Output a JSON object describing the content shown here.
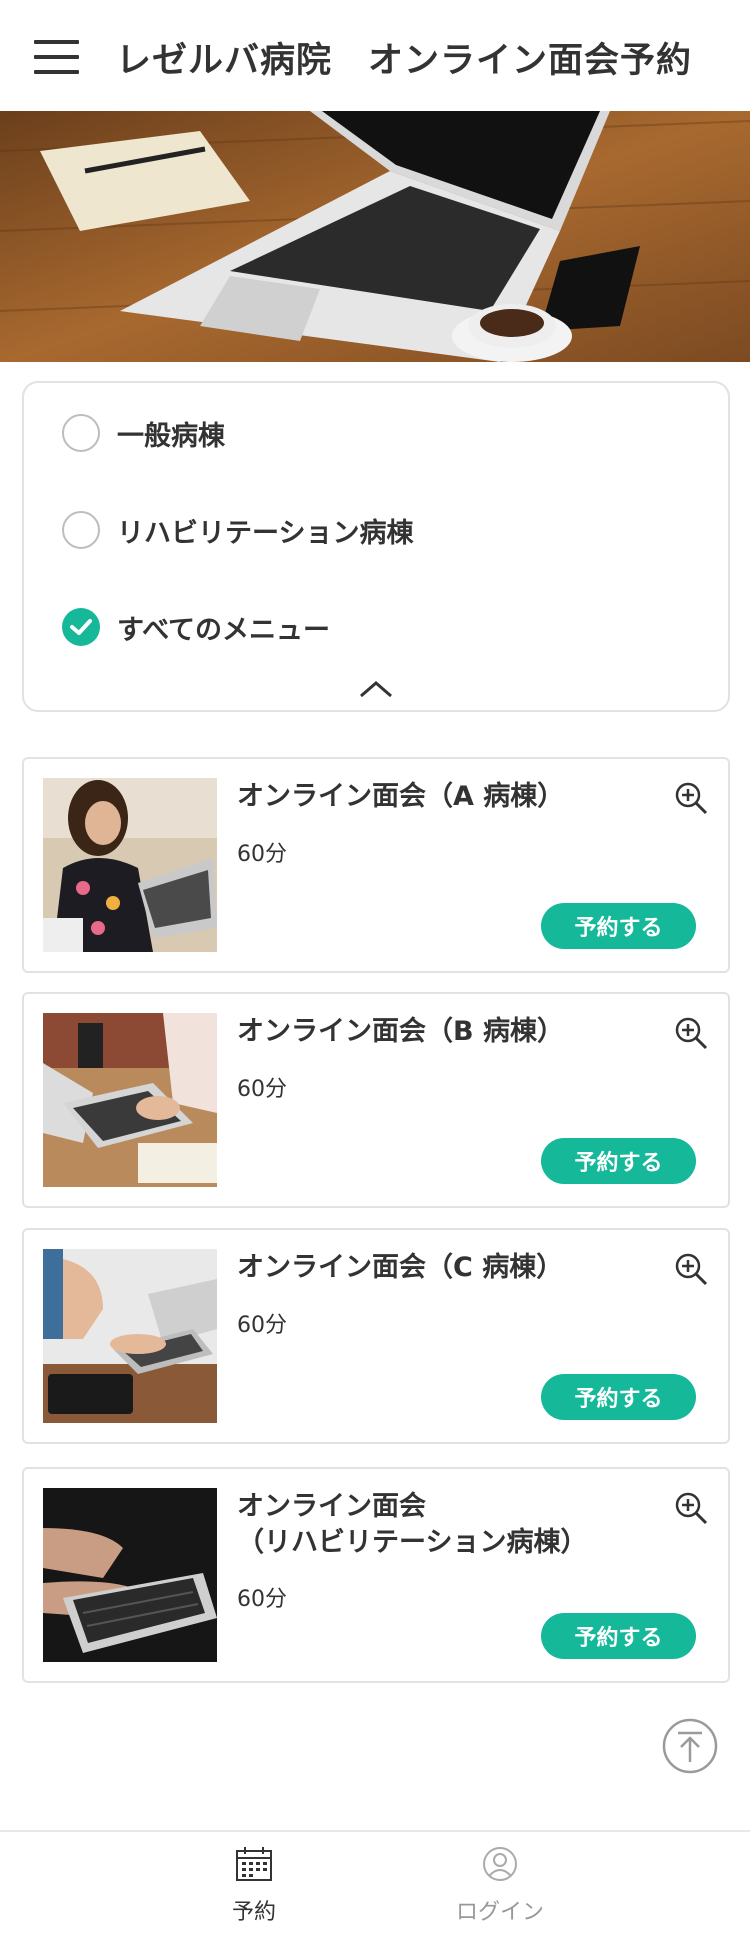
{
  "header": {
    "title": "レゼルバ病院　オンライン面会予約",
    "menu_icon": "hamburger-menu-icon"
  },
  "hero": {
    "description_icon": "hero-image"
  },
  "filter": {
    "options": [
      {
        "label": "一般病棟",
        "checked": false
      },
      {
        "label": "リハビリテーション病棟",
        "checked": false
      },
      {
        "label": "すべてのメニュー",
        "checked": true
      }
    ],
    "collapse_icon": "chevron-up-icon"
  },
  "menus": [
    {
      "title": "オンライン面会（A 病棟）",
      "duration": "60分",
      "button": "予約する"
    },
    {
      "title": "オンライン面会（B 病棟）",
      "duration": "60分",
      "button": "予約する"
    },
    {
      "title": "オンライン面会（C 病棟）",
      "duration": "60分",
      "button": "予約する"
    },
    {
      "title": "オンライン面会\n（リハビリテーション病棟）",
      "duration": "60分",
      "button": "予約する"
    }
  ],
  "bottom_nav": {
    "items": [
      {
        "label": "予約",
        "icon": "calendar-icon",
        "active": true
      },
      {
        "label": "ログイン",
        "icon": "user-icon",
        "active": false
      }
    ]
  },
  "colors": {
    "accent": "#16b89a",
    "text": "#333333",
    "border": "#e2e2e2",
    "muted": "#999999"
  }
}
